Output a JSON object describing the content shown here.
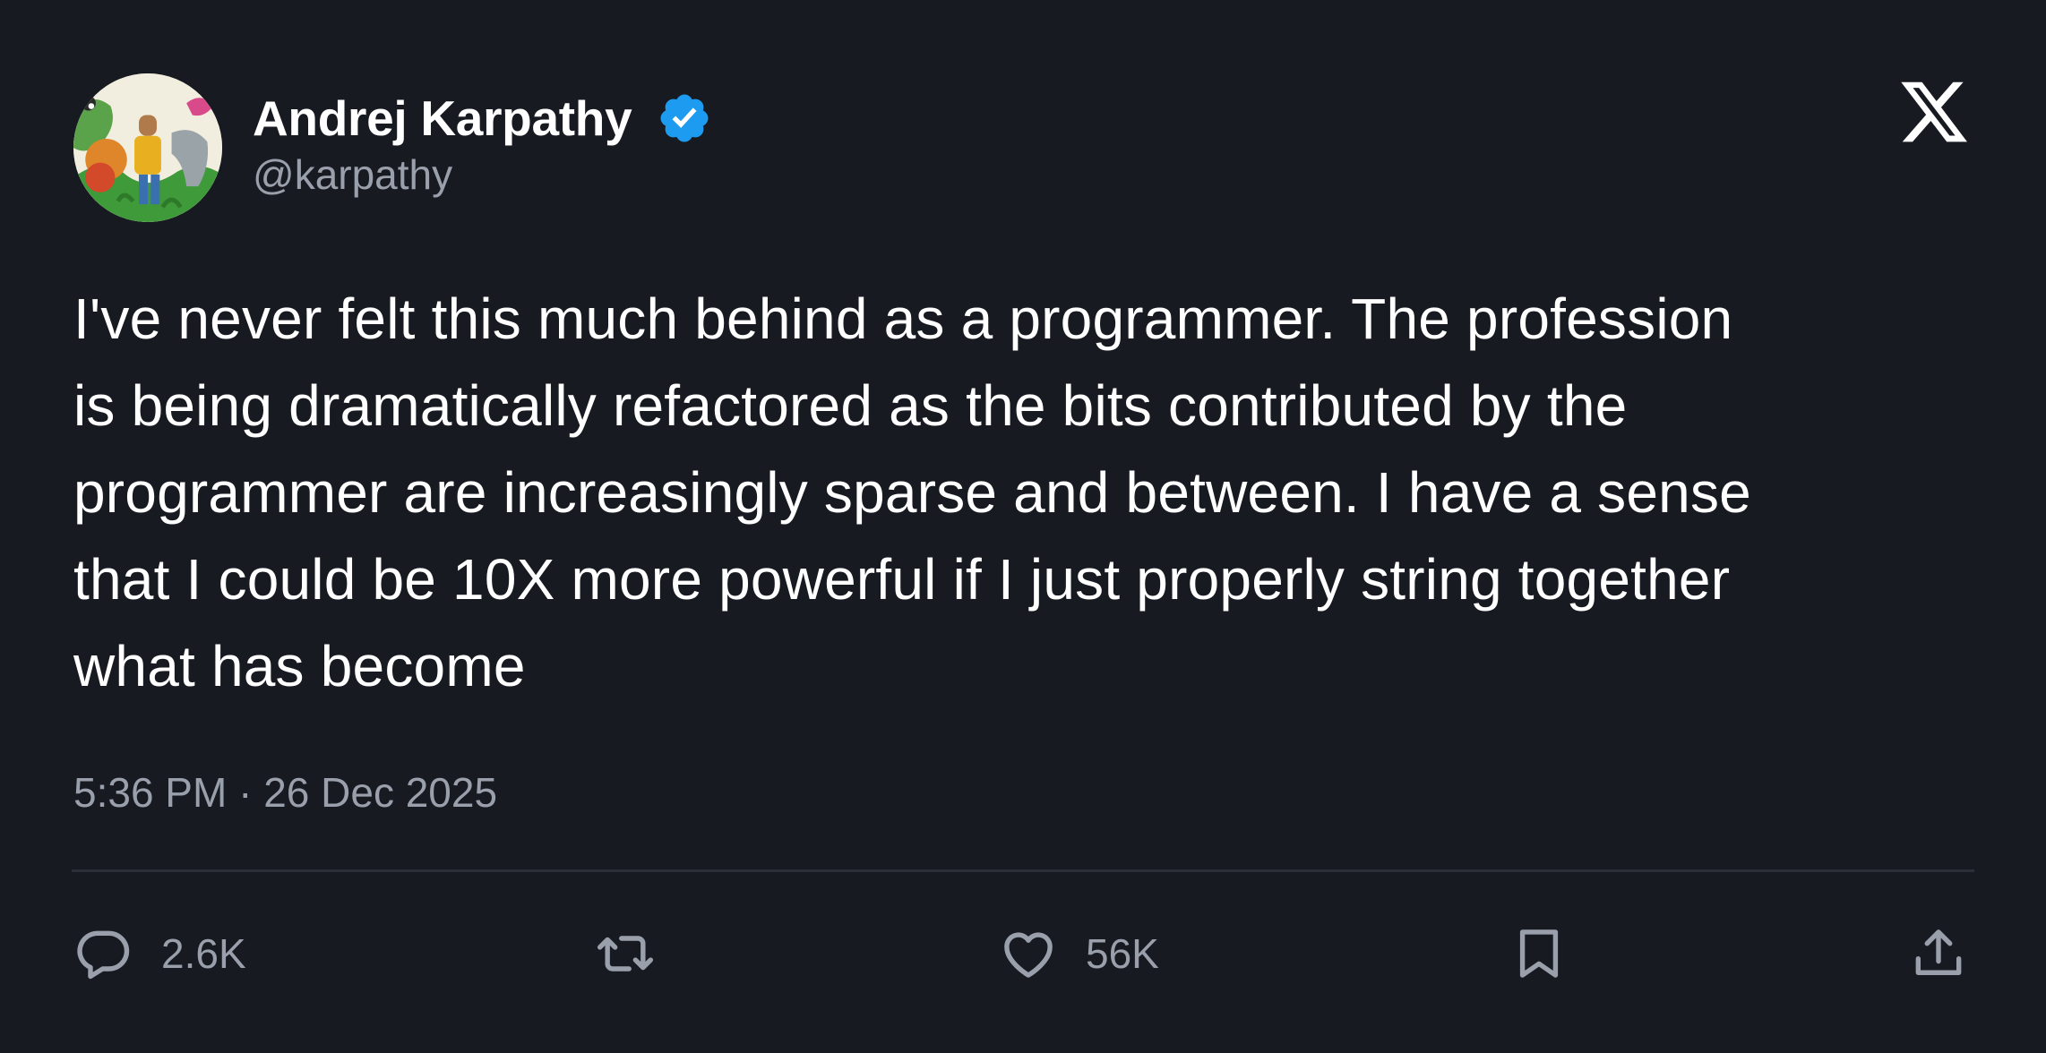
{
  "author": {
    "display_name": "Andrej Karpathy",
    "handle": "@karpathy",
    "verified": true,
    "verified_color": "#1d9bf0",
    "avatar_icon": "illustrated-avatar"
  },
  "brand": {
    "logo_icon": "x-logo-icon"
  },
  "tweet": {
    "lines": [
      "I've never felt this much behind as a programmer. The profession",
      "is being dramatically refactored as the bits contributed by the",
      "programmer are increasingly sparse and between. I have a sense",
      "that I could be 10X more powerful if I just properly string together",
      "what has become"
    ],
    "timestamp": "5:36 PM · 26 Dec 2025"
  },
  "actions": {
    "reply": {
      "icon": "reply-icon",
      "count": "2.6K"
    },
    "retweet": {
      "icon": "retweet-icon"
    },
    "like": {
      "icon": "heart-icon",
      "count": "56K"
    },
    "bookmark": {
      "icon": "bookmark-icon"
    },
    "share": {
      "icon": "share-icon"
    }
  },
  "colors": {
    "background": "#181a22",
    "primary_text": "#ffffff",
    "secondary_text": "#9aa0ab",
    "divider": "#2c2f38"
  }
}
